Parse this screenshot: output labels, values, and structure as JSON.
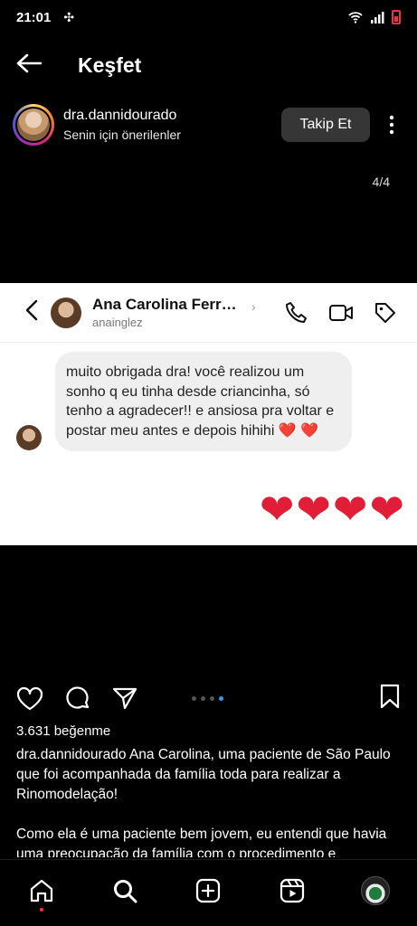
{
  "status_bar": {
    "time": "21:01"
  },
  "header": {
    "title": "Keşfet"
  },
  "profile": {
    "username": "dra.dannidourado",
    "subtitle": "Senin için önerilenler",
    "follow_label": "Takip Et"
  },
  "carousel": {
    "counter": "4/4",
    "current": 4,
    "total": 4
  },
  "chat_screenshot": {
    "contact_name": "Ana Carolina Ferr…",
    "contact_handle": "anainglez",
    "message": "muito obrigada dra! você realizou um sonho q eu tinha desde criancinha, só tenho a agradecer!! e ansiosa pra voltar e postar meu antes e depois hihihi ❤️ ❤️",
    "hearts": "❤❤❤❤"
  },
  "post": {
    "likes": "3.631 beğenme",
    "caption_p1": "dra.dannidourado Ana Carolina, uma paciente de São Paulo que foi acompanhada da família toda para realizar a Rinomodelação!",
    "caption_p2": "Como ela é uma paciente bem jovem, eu entendi que havia uma preocupação da família com o procedimento e"
  },
  "colors": {
    "accent": "#3897f0",
    "heart": "#e01e37",
    "notification": "#ff3040"
  },
  "icons": [
    "back-arrow-icon",
    "more-vertical-icon",
    "phone-icon",
    "video-icon",
    "tag-icon",
    "heart-icon",
    "comment-icon",
    "share-icon",
    "bookmark-icon",
    "home-icon",
    "search-icon",
    "create-icon",
    "reels-icon",
    "profile-avatar"
  ]
}
